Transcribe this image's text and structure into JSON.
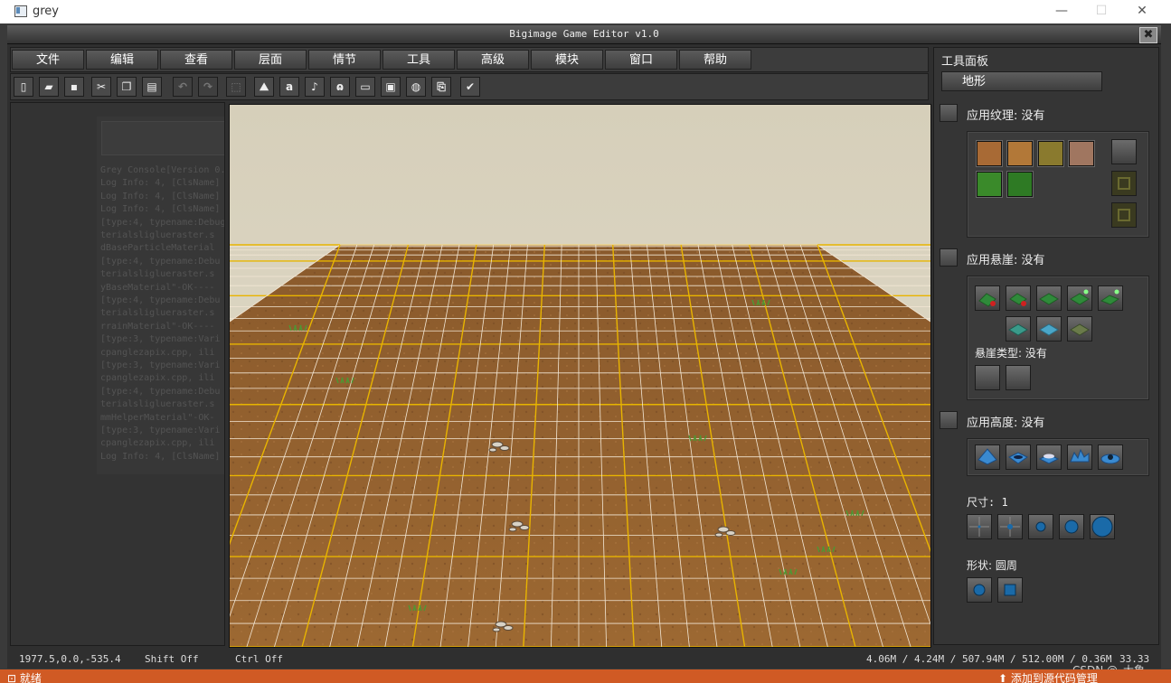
{
  "window": {
    "title": "grey",
    "minimize": "—",
    "maximize": "☐",
    "close": "✕"
  },
  "editor": {
    "title": "Bigimage Game Editor v1.0",
    "close": "✖"
  },
  "menu": [
    "文件",
    "编辑",
    "查看",
    "层面",
    "情节",
    "工具",
    "高级",
    "模块",
    "窗口",
    "帮助"
  ],
  "toolbar": [
    {
      "icon": "new-file-icon",
      "glyph": "▯",
      "enabled": true
    },
    {
      "icon": "open-folder-icon",
      "glyph": "▰",
      "enabled": true
    },
    {
      "icon": "save-icon",
      "glyph": "▪",
      "enabled": true
    },
    {
      "icon": "cut-icon",
      "glyph": "✂",
      "enabled": true
    },
    {
      "icon": "copy-icon",
      "glyph": "❐",
      "enabled": true
    },
    {
      "icon": "paste-icon",
      "glyph": "▤",
      "enabled": true
    },
    {
      "icon": "undo-icon",
      "glyph": "↶",
      "enabled": false
    },
    {
      "icon": "redo-icon",
      "glyph": "↷",
      "enabled": false
    },
    {
      "icon": "select-icon",
      "glyph": "⬚",
      "enabled": false
    },
    {
      "icon": "terrain-icon",
      "glyph": "⛰",
      "enabled": true
    },
    {
      "icon": "text-icon",
      "glyph": "a",
      "enabled": true
    },
    {
      "icon": "sound-icon",
      "glyph": "♪",
      "enabled": true
    },
    {
      "icon": "ear-icon",
      "glyph": "ɷ",
      "enabled": true
    },
    {
      "icon": "book-icon",
      "glyph": "▭",
      "enabled": true
    },
    {
      "icon": "trigger-icon",
      "glyph": "▣",
      "enabled": true
    },
    {
      "icon": "object-icon",
      "glyph": "◍",
      "enabled": true
    },
    {
      "icon": "export-icon",
      "glyph": "⎘",
      "enabled": true
    },
    {
      "icon": "check-icon",
      "glyph": "✔",
      "enabled": true
    }
  ],
  "console_lines": [
    "Grey Console[Version 0.",
    "Log Info: 4, [ClsName]",
    "Log Info: 4, [ClsName]",
    "Log Info: 4, [ClsName]",
    "[type:4, typename:Debug",
    "terialsliglueraster.s",
    "dBaseParticleMaterial",
    "[type:4, typename:Debu",
    "terialsliglueraster.s",
    "yBaseMaterial\"-OK----",
    "[type:4, typename:Debu",
    "terialsliglueraster.s",
    "rrainMaterial\"-OK----",
    "[type:3, typename:Vari",
    "cpanglezapix.cpp, ili",
    "[type:3, typename:Vari",
    "cpanglezapix.cpp, ili",
    "[type:4, typename:Debu",
    "terialsliglueraster.s",
    "mmHelperMaterial\"-OK-",
    "[type:3, typename:Vari",
    "cpanglezapix.cpp, ili",
    "Log Info: 4, [ClsName]"
  ],
  "panel": {
    "title": "工具面板",
    "tab": "地形",
    "apply_texture": "应用纹理: 没有",
    "apply_cliff": "应用悬崖: 没有",
    "cliff_type": "悬崖类型: 没有",
    "apply_height": "应用高度: 没有",
    "size": "尺寸: 1",
    "shape": "形状: 圆周"
  },
  "texture_colors": [
    "#a86a35",
    "#b27838",
    "#8a7a2e",
    "#a07660",
    "#3a8a2a",
    "#2e7a24"
  ],
  "colors": {
    "accent": "#e8b400",
    "viewport_sky": "#d9d2be",
    "ground": "#96622f"
  },
  "status": {
    "coords": "1977.5,0.0,-535.4",
    "shift": "Shift Off",
    "ctrl": "Ctrl Off",
    "memory": "4.06M / 4.24M / 507.94M / 512.00M / 0.36M",
    "fps": "33.33"
  },
  "taskbar": {
    "left": "就绪",
    "right": "添加到源代码管理"
  },
  "watermark": "CSDN @_大象_"
}
